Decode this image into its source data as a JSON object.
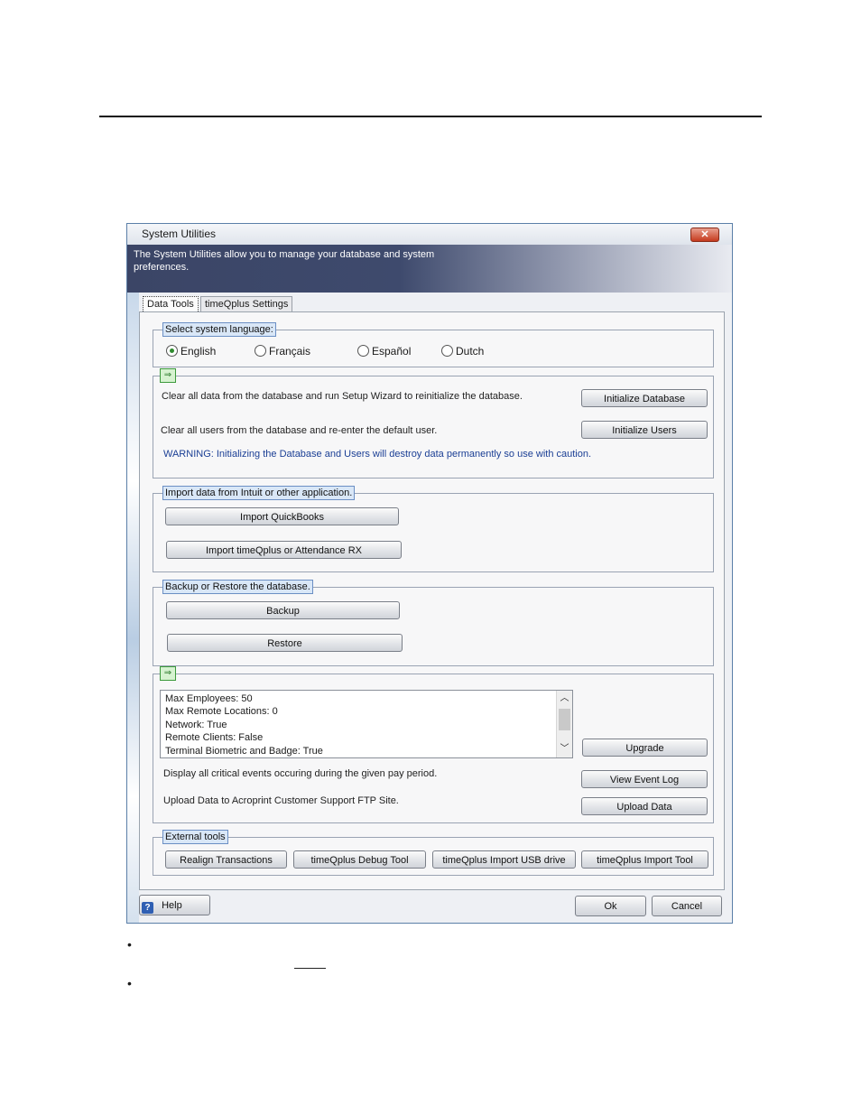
{
  "window": {
    "title": "System Utilities",
    "close_symbol": "✕",
    "banner": "The System Utilities allow you to manage your database and system preferences."
  },
  "tabs": [
    {
      "label": "Data Tools",
      "active": true
    },
    {
      "label": "timeQplus Settings",
      "active": false
    }
  ],
  "language": {
    "legend": "Select system language:",
    "options": [
      {
        "label": "English",
        "selected": true
      },
      {
        "label": "Français",
        "selected": false
      },
      {
        "label": "Español",
        "selected": false
      },
      {
        "label": "Dutch",
        "selected": false
      }
    ]
  },
  "init": {
    "icon": "arrow-into-box-icon",
    "icon_glyph": "⇒",
    "clear_data_text": "Clear all data from the database and run Setup Wizard to reinitialize the database.",
    "init_db_label": "Initialize Database",
    "clear_users_text": "Clear all users from the database and re-enter the default user.",
    "init_users_label": "Initialize Users",
    "warning": "WARNING: Initializing the Database and Users will destroy data permanently so use with caution."
  },
  "import": {
    "legend": "Import data from Intuit or other application.",
    "quickbooks_label": "Import QuickBooks",
    "timeqplus_label": "Import timeQplus or Attendance RX"
  },
  "backup": {
    "legend": "Backup or Restore the database.",
    "backup_label": "Backup",
    "restore_label": "Restore"
  },
  "license": {
    "icon": "arrow-into-box-icon",
    "icon_glyph": "⇒",
    "lines": [
      "Max Employees: 50",
      "Max Remote Locations: 0",
      "Network: True",
      "Remote Clients: False",
      "Terminal Biometric and Badge: True"
    ],
    "upgrade_label": "Upgrade",
    "events_text": "Display all critical events occuring during the given pay period.",
    "event_log_label": "View Event Log",
    "upload_text": "Upload Data to Acroprint Customer Support FTP Site.",
    "upload_label": "Upload Data"
  },
  "external": {
    "legend": "External tools",
    "buttons": [
      "Realign Transactions",
      "timeQplus Debug Tool",
      "timeQplus Import USB drive",
      "timeQplus Import Tool"
    ]
  },
  "footer": {
    "help_icon_glyph": "?",
    "help_label": "Help",
    "ok_label": "Ok",
    "cancel_label": "Cancel"
  },
  "page": {
    "bullet_glyph": "•"
  },
  "colors": {
    "banner": "#3b4566",
    "legend_bg": "#d9e7f7",
    "warning": "#1b3f95",
    "close_button": "#c53a1e"
  }
}
